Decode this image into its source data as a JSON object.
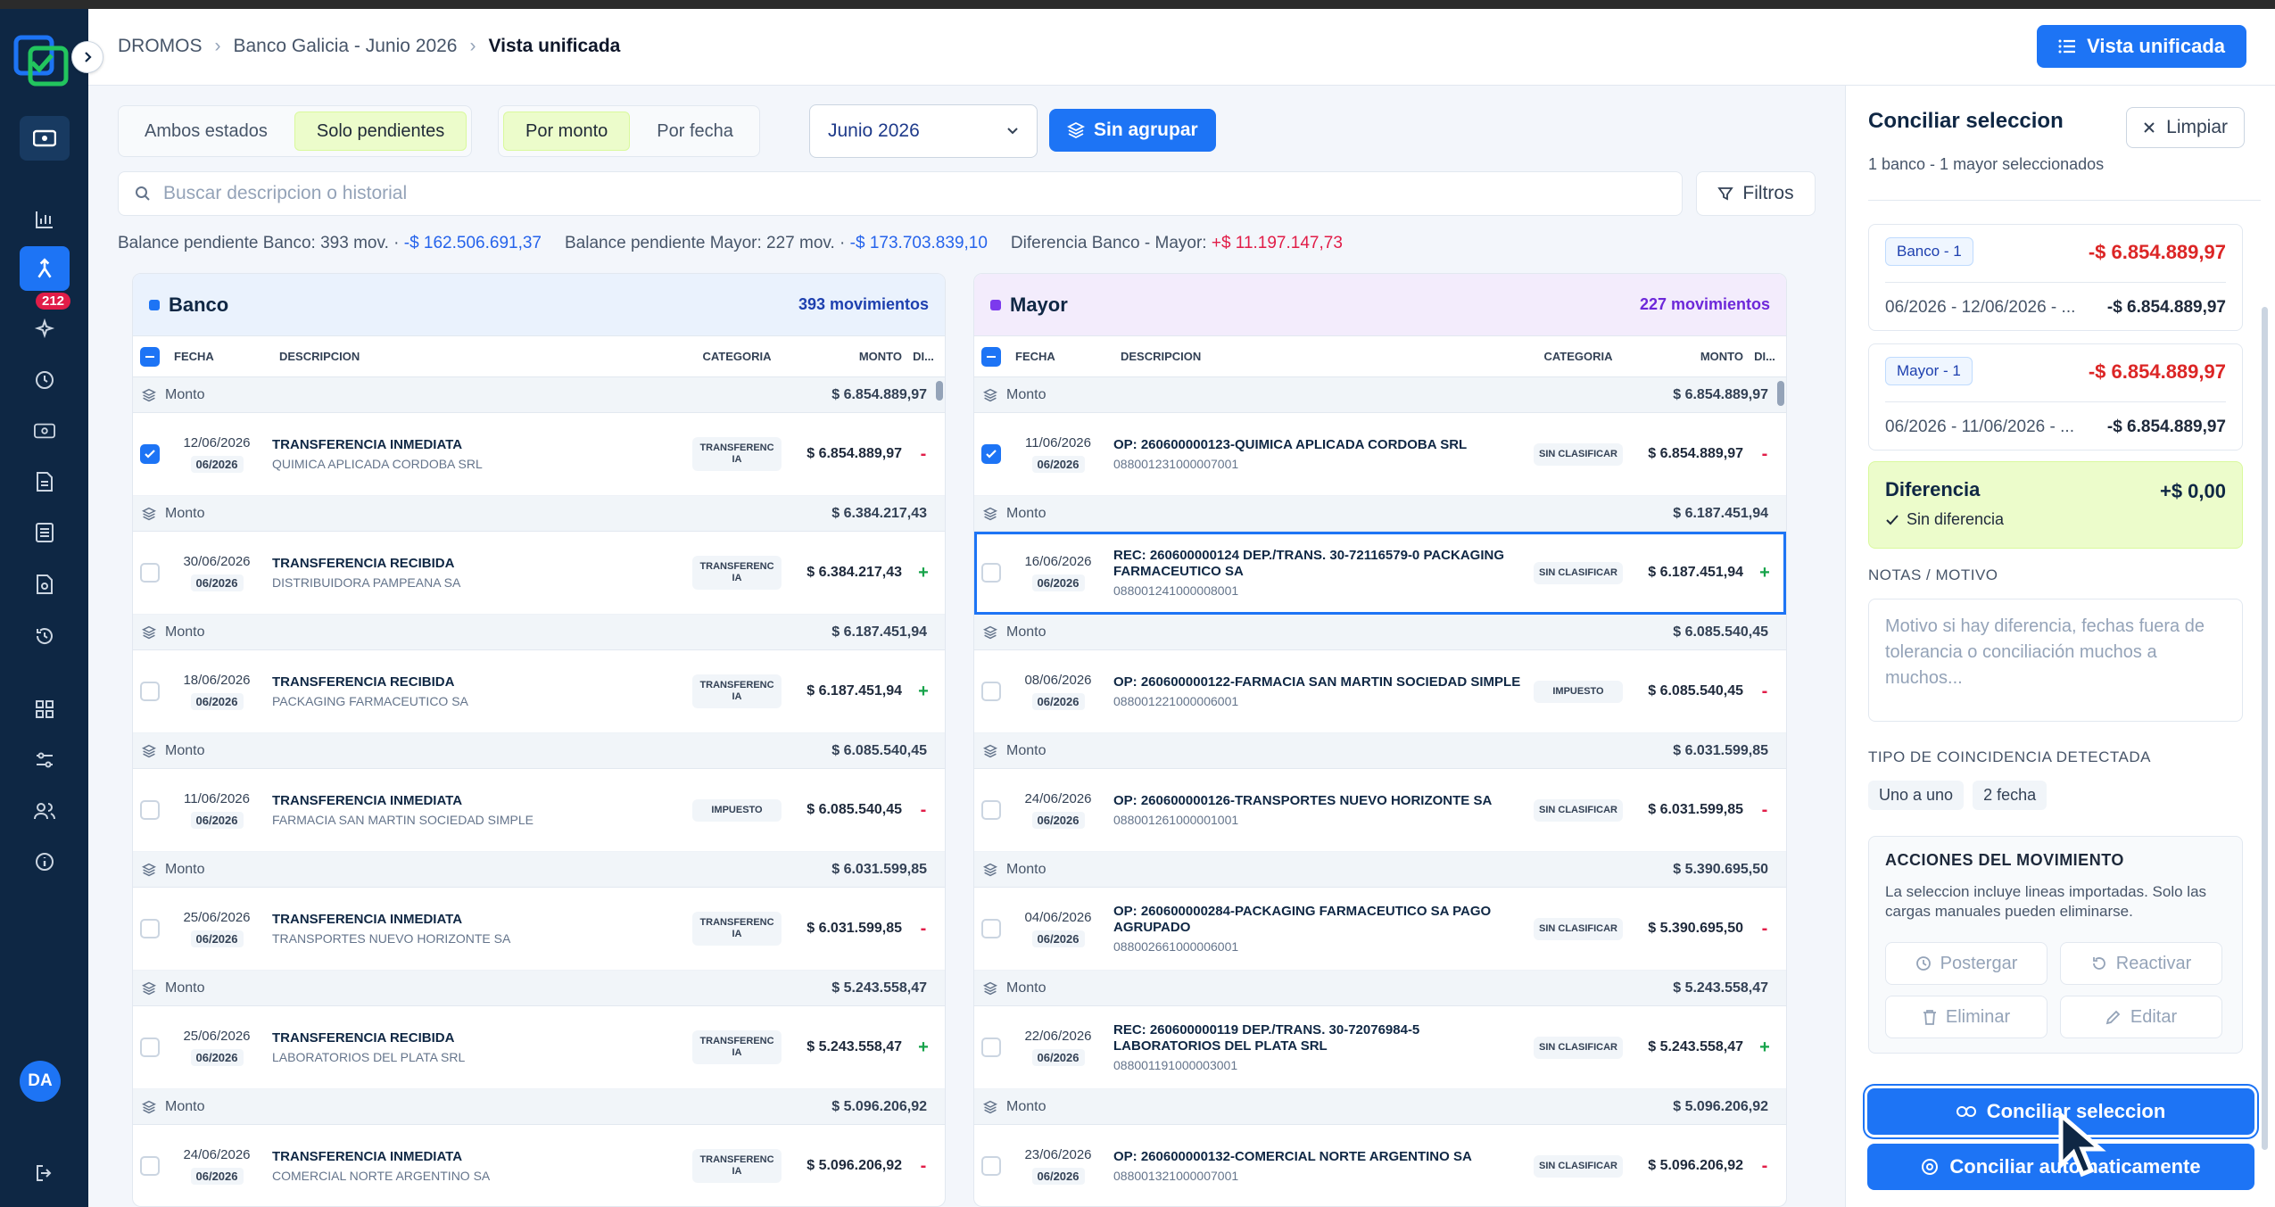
{
  "breadcrumb": {
    "root": "DROMOS",
    "parent": "Banco Galicia - Junio 2026",
    "current": "Vista unificada"
  },
  "header": {
    "view_button": "Vista unificada"
  },
  "sidebar": {
    "badge": "212",
    "avatar": "DA"
  },
  "toolbar": {
    "estado": [
      "Ambos estados",
      "Solo pendientes"
    ],
    "orden": [
      "Por monto",
      "Por fecha"
    ],
    "period": "Junio 2026",
    "group_button": "Sin agrupar",
    "search_placeholder": "Buscar descripcion o historial",
    "filters": "Filtros"
  },
  "balances": {
    "banco_label": "Balance pendiente Banco: 393 mov. ·",
    "banco_value": "-$ 162.506.691,37",
    "mayor_label": "Balance pendiente Mayor: 227 mov. ·",
    "mayor_value": "-$ 173.703.839,10",
    "diff_label": "Diferencia Banco - Mayor:",
    "diff_value": "+$ 11.197.147,73"
  },
  "columns": {
    "fecha": "FECHA",
    "descripcion": "DESCRIPCION",
    "categoria": "CATEGORIA",
    "monto": "MONTO",
    "di": "DI..."
  },
  "banco": {
    "title": "Banco",
    "count": "393 movimientos",
    "groups": [
      {
        "label": "Monto",
        "value": "$ 6.854.889,97",
        "date": "12/06/2026",
        "month": "06/2026",
        "title": "TRANSFERENCIA INMEDIATA",
        "sub": "QUIMICA APLICADA CORDOBA SRL",
        "cat": "TRANSFERENC IA",
        "amount": "$ 6.854.889,97",
        "sign": "-",
        "checked": true
      },
      {
        "label": "Monto",
        "value": "$ 6.384.217,43",
        "date": "30/06/2026",
        "month": "06/2026",
        "title": "TRANSFERENCIA RECIBIDA",
        "sub": "DISTRIBUIDORA PAMPEANA SA",
        "cat": "TRANSFERENC IA",
        "amount": "$ 6.384.217,43",
        "sign": "+",
        "checked": false
      },
      {
        "label": "Monto",
        "value": "$ 6.187.451,94",
        "date": "18/06/2026",
        "month": "06/2026",
        "title": "TRANSFERENCIA RECIBIDA",
        "sub": "PACKAGING FARMACEUTICO SA",
        "cat": "TRANSFERENC IA",
        "amount": "$ 6.187.451,94",
        "sign": "+",
        "checked": false
      },
      {
        "label": "Monto",
        "value": "$ 6.085.540,45",
        "date": "11/06/2026",
        "month": "06/2026",
        "title": "TRANSFERENCIA INMEDIATA",
        "sub": "FARMACIA SAN MARTIN SOCIEDAD SIMPLE",
        "cat": "IMPUESTO",
        "amount": "$ 6.085.540,45",
        "sign": "-",
        "checked": false
      },
      {
        "label": "Monto",
        "value": "$ 6.031.599,85",
        "date": "25/06/2026",
        "month": "06/2026",
        "title": "TRANSFERENCIA INMEDIATA",
        "sub": "TRANSPORTES NUEVO HORIZONTE SA",
        "cat": "TRANSFERENC IA",
        "amount": "$ 6.031.599,85",
        "sign": "-",
        "checked": false
      },
      {
        "label": "Monto",
        "value": "$ 5.243.558,47",
        "date": "25/06/2026",
        "month": "06/2026",
        "title": "TRANSFERENCIA RECIBIDA",
        "sub": "LABORATORIOS DEL PLATA SRL",
        "cat": "TRANSFERENC IA",
        "amount": "$ 5.243.558,47",
        "sign": "+",
        "checked": false
      },
      {
        "label": "Monto",
        "value": "$ 5.096.206,92",
        "date": "24/06/2026",
        "month": "06/2026",
        "title": "TRANSFERENCIA INMEDIATA",
        "sub": "COMERCIAL NORTE ARGENTINO SA",
        "cat": "TRANSFERENC IA",
        "amount": "$ 5.096.206,92",
        "sign": "-",
        "checked": false
      }
    ]
  },
  "mayor": {
    "title": "Mayor",
    "count": "227 movimientos",
    "groups": [
      {
        "label": "Monto",
        "value": "$ 6.854.889,97",
        "date": "11/06/2026",
        "month": "06/2026",
        "title": "OP: 260600000123-QUIMICA APLICADA CORDOBA SRL",
        "sub": "088001231000007001",
        "cat": "SIN CLASIFICAR",
        "amount": "$ 6.854.889,97",
        "sign": "-",
        "checked": true
      },
      {
        "label": "Monto",
        "value": "$ 6.187.451,94",
        "date": "16/06/2026",
        "month": "06/2026",
        "title": "REC: 260600000124 DEP./TRANS. 30-72116579-0 PACKAGING FARMACEUTICO SA",
        "sub": "088001241000008001",
        "cat": "SIN CLASIFICAR",
        "amount": "$ 6.187.451,94",
        "sign": "+",
        "checked": false
      },
      {
        "label": "Monto",
        "value": "$ 6.085.540,45",
        "date": "08/06/2026",
        "month": "06/2026",
        "title": "OP: 260600000122-FARMACIA SAN MARTIN SOCIEDAD SIMPLE",
        "sub": "088001221000006001",
        "cat": "IMPUESTO",
        "amount": "$ 6.085.540,45",
        "sign": "-",
        "checked": false
      },
      {
        "label": "Monto",
        "value": "$ 6.031.599,85",
        "date": "24/06/2026",
        "month": "06/2026",
        "title": "OP: 260600000126-TRANSPORTES NUEVO HORIZONTE SA",
        "sub": "088001261000001001",
        "cat": "SIN CLASIFICAR",
        "amount": "$ 6.031.599,85",
        "sign": "-",
        "checked": false
      },
      {
        "label": "Monto",
        "value": "$ 5.390.695,50",
        "date": "04/06/2026",
        "month": "06/2026",
        "title": "OP: 260600000284-PACKAGING FARMACEUTICO SA PAGO AGRUPADO",
        "sub": "088002661000006001",
        "cat": "SIN CLASIFICAR",
        "amount": "$ 5.390.695,50",
        "sign": "-",
        "checked": false
      },
      {
        "label": "Monto",
        "value": "$ 5.243.558,47",
        "date": "22/06/2026",
        "month": "06/2026",
        "title": "REC: 260600000119 DEP./TRANS. 30-72076984-5 LABORATORIOS DEL PLATA SRL",
        "sub": "088001191000003001",
        "cat": "SIN CLASIFICAR",
        "amount": "$ 5.243.558,47",
        "sign": "+",
        "checked": false
      },
      {
        "label": "Monto",
        "value": "$ 5.096.206,92",
        "date": "23/06/2026",
        "month": "06/2026",
        "title": "OP: 260600000132-COMERCIAL NORTE ARGENTINO SA",
        "sub": "088001321000007001",
        "cat": "SIN CLASIFICAR",
        "amount": "$ 5.096.206,92",
        "sign": "-",
        "checked": false
      }
    ]
  },
  "panel": {
    "title": "Conciliar seleccion",
    "clear": "Limpiar",
    "subtitle": "1 banco - 1 mayor seleccionados",
    "banco_card": {
      "chip": "Banco - 1",
      "total": "-$ 6.854.889,97",
      "range": "06/2026 - 12/06/2026 - ...",
      "amount": "-$ 6.854.889,97"
    },
    "mayor_card": {
      "chip": "Mayor - 1",
      "total": "-$ 6.854.889,97",
      "range": "06/2026 - 11/06/2026 - ...",
      "amount": "-$ 6.854.889,97"
    },
    "diff_title": "Diferencia",
    "diff_value": "+$ 0,00",
    "diff_status": "Sin diferencia",
    "notes_label": "NOTAS / MOTIVO",
    "notes_placeholder": "Motivo si hay diferencia, fechas fuera de tolerancia o conciliación muchos a muchos...",
    "match_label": "TIPO DE COINCIDENCIA DETECTADA",
    "match_tags": [
      "Uno a uno",
      "2 fecha"
    ],
    "actions_title": "ACCIONES DEL MOVIMIENTO",
    "actions_note": "La seleccion incluye lineas importadas. Solo las cargas manuales pueden eliminarse.",
    "actions": [
      "Postergar",
      "Reactivar",
      "Eliminar",
      "Editar"
    ],
    "primary": "Conciliar seleccion",
    "auto": "Conciliar automaticamente"
  },
  "colors": {
    "accent": "#1d74f5",
    "sidebar": "#0e2744",
    "negative": "#e11d48",
    "positive": "#16a34a"
  }
}
